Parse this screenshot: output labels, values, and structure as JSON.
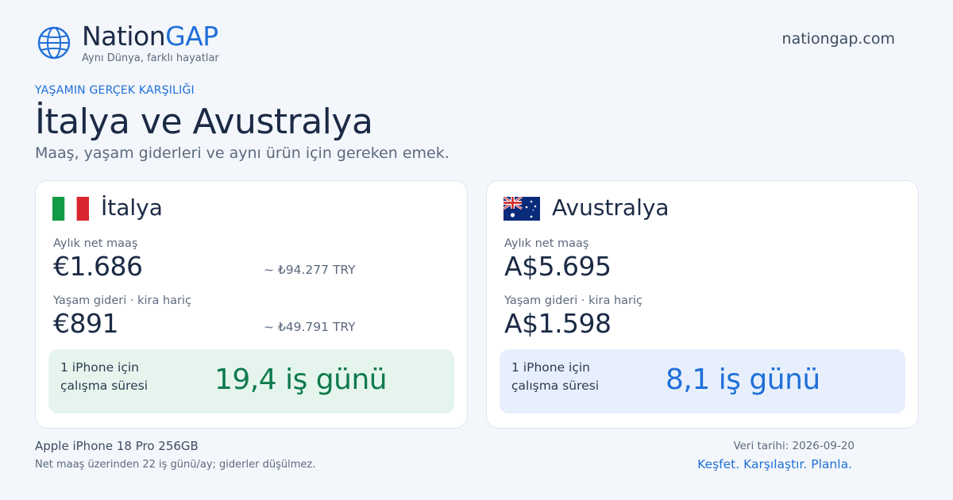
{
  "header": {
    "brand_main": "Nation",
    "brand_accent": "GAP",
    "tagline": "Aynı Dünya, farklı hayatlar",
    "site_url": "nationgap.com",
    "logo_icon": "globe-icon"
  },
  "intro": {
    "eyebrow": "YAŞAMIN GERÇEK KARŞILIĞI",
    "title": "İtalya ve Avustralya",
    "subtitle": "Maaş, yaşam giderleri ve aynı ürün için gereken emek."
  },
  "countries": [
    {
      "name": "İtalya",
      "flag_icon": "italy-flag-icon",
      "salary_label": "Aylık net maaş",
      "salary_value": "€1.686",
      "salary_try": "~ ₺94.277 TRY",
      "cost_label": "Yaşam gideri · kira hariç",
      "cost_value": "€891",
      "cost_try": "~ ₺49.791 TRY",
      "work_label": "1 iPhone için çalışma süresi",
      "work_value": "19,4 iş günü",
      "accent_color": "#0e7a4c"
    },
    {
      "name": "Avustralya",
      "flag_icon": "australia-flag-icon",
      "salary_label": "Aylık net maaş",
      "salary_value": "A$5.695",
      "cost_label": "Yaşam gideri · kira hariç",
      "cost_value": "A$1.598",
      "work_label": "1 iPhone için çalışma süresi",
      "work_value": "8,1 iş günü",
      "accent_color": "#1f6fd8"
    }
  ],
  "footer": {
    "product": "Apple iPhone 18 Pro 256GB",
    "note": "Net maaş üzerinden 22 iş günü/ay; giderler düşülmez.",
    "data_date": "Veri tarihi: 2026-09-20",
    "cta": "Keşfet. Karşılaştır. Planla."
  },
  "colors": {
    "brand_blue": "#1f6fd8",
    "text_dark": "#1b2a45",
    "background": "#f3f6fa"
  }
}
